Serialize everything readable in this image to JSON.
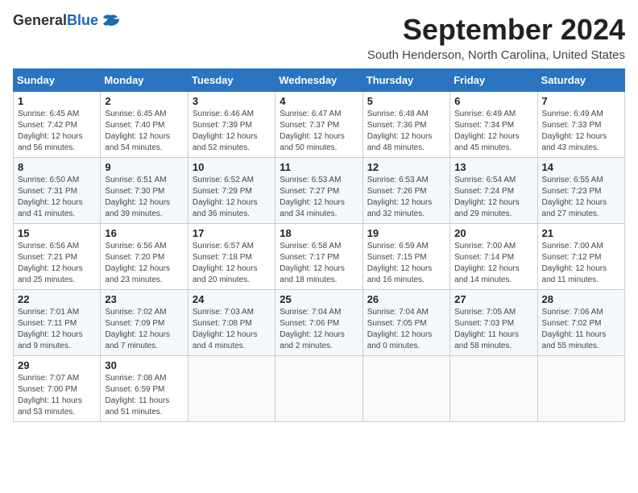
{
  "logo": {
    "general": "General",
    "blue": "Blue"
  },
  "title": "September 2024",
  "location": "South Henderson, North Carolina, United States",
  "days_of_week": [
    "Sunday",
    "Monday",
    "Tuesday",
    "Wednesday",
    "Thursday",
    "Friday",
    "Saturday"
  ],
  "weeks": [
    [
      {
        "day": "1",
        "sunrise": "6:45 AM",
        "sunset": "7:42 PM",
        "daylight": "12 hours and 56 minutes."
      },
      {
        "day": "2",
        "sunrise": "6:45 AM",
        "sunset": "7:40 PM",
        "daylight": "12 hours and 54 minutes."
      },
      {
        "day": "3",
        "sunrise": "6:46 AM",
        "sunset": "7:39 PM",
        "daylight": "12 hours and 52 minutes."
      },
      {
        "day": "4",
        "sunrise": "6:47 AM",
        "sunset": "7:37 PM",
        "daylight": "12 hours and 50 minutes."
      },
      {
        "day": "5",
        "sunrise": "6:48 AM",
        "sunset": "7:36 PM",
        "daylight": "12 hours and 48 minutes."
      },
      {
        "day": "6",
        "sunrise": "6:49 AM",
        "sunset": "7:34 PM",
        "daylight": "12 hours and 45 minutes."
      },
      {
        "day": "7",
        "sunrise": "6:49 AM",
        "sunset": "7:33 PM",
        "daylight": "12 hours and 43 minutes."
      }
    ],
    [
      {
        "day": "8",
        "sunrise": "6:50 AM",
        "sunset": "7:31 PM",
        "daylight": "12 hours and 41 minutes."
      },
      {
        "day": "9",
        "sunrise": "6:51 AM",
        "sunset": "7:30 PM",
        "daylight": "12 hours and 39 minutes."
      },
      {
        "day": "10",
        "sunrise": "6:52 AM",
        "sunset": "7:29 PM",
        "daylight": "12 hours and 36 minutes."
      },
      {
        "day": "11",
        "sunrise": "6:53 AM",
        "sunset": "7:27 PM",
        "daylight": "12 hours and 34 minutes."
      },
      {
        "day": "12",
        "sunrise": "6:53 AM",
        "sunset": "7:26 PM",
        "daylight": "12 hours and 32 minutes."
      },
      {
        "day": "13",
        "sunrise": "6:54 AM",
        "sunset": "7:24 PM",
        "daylight": "12 hours and 29 minutes."
      },
      {
        "day": "14",
        "sunrise": "6:55 AM",
        "sunset": "7:23 PM",
        "daylight": "12 hours and 27 minutes."
      }
    ],
    [
      {
        "day": "15",
        "sunrise": "6:56 AM",
        "sunset": "7:21 PM",
        "daylight": "12 hours and 25 minutes."
      },
      {
        "day": "16",
        "sunrise": "6:56 AM",
        "sunset": "7:20 PM",
        "daylight": "12 hours and 23 minutes."
      },
      {
        "day": "17",
        "sunrise": "6:57 AM",
        "sunset": "7:18 PM",
        "daylight": "12 hours and 20 minutes."
      },
      {
        "day": "18",
        "sunrise": "6:58 AM",
        "sunset": "7:17 PM",
        "daylight": "12 hours and 18 minutes."
      },
      {
        "day": "19",
        "sunrise": "6:59 AM",
        "sunset": "7:15 PM",
        "daylight": "12 hours and 16 minutes."
      },
      {
        "day": "20",
        "sunrise": "7:00 AM",
        "sunset": "7:14 PM",
        "daylight": "12 hours and 14 minutes."
      },
      {
        "day": "21",
        "sunrise": "7:00 AM",
        "sunset": "7:12 PM",
        "daylight": "12 hours and 11 minutes."
      }
    ],
    [
      {
        "day": "22",
        "sunrise": "7:01 AM",
        "sunset": "7:11 PM",
        "daylight": "12 hours and 9 minutes."
      },
      {
        "day": "23",
        "sunrise": "7:02 AM",
        "sunset": "7:09 PM",
        "daylight": "12 hours and 7 minutes."
      },
      {
        "day": "24",
        "sunrise": "7:03 AM",
        "sunset": "7:08 PM",
        "daylight": "12 hours and 4 minutes."
      },
      {
        "day": "25",
        "sunrise": "7:04 AM",
        "sunset": "7:06 PM",
        "daylight": "12 hours and 2 minutes."
      },
      {
        "day": "26",
        "sunrise": "7:04 AM",
        "sunset": "7:05 PM",
        "daylight": "12 hours and 0 minutes."
      },
      {
        "day": "27",
        "sunrise": "7:05 AM",
        "sunset": "7:03 PM",
        "daylight": "11 hours and 58 minutes."
      },
      {
        "day": "28",
        "sunrise": "7:06 AM",
        "sunset": "7:02 PM",
        "daylight": "11 hours and 55 minutes."
      }
    ],
    [
      {
        "day": "29",
        "sunrise": "7:07 AM",
        "sunset": "7:00 PM",
        "daylight": "11 hours and 53 minutes."
      },
      {
        "day": "30",
        "sunrise": "7:08 AM",
        "sunset": "6:59 PM",
        "daylight": "11 hours and 51 minutes."
      },
      null,
      null,
      null,
      null,
      null
    ]
  ],
  "labels": {
    "sunrise": "Sunrise:",
    "sunset": "Sunset:",
    "daylight": "Daylight:"
  }
}
